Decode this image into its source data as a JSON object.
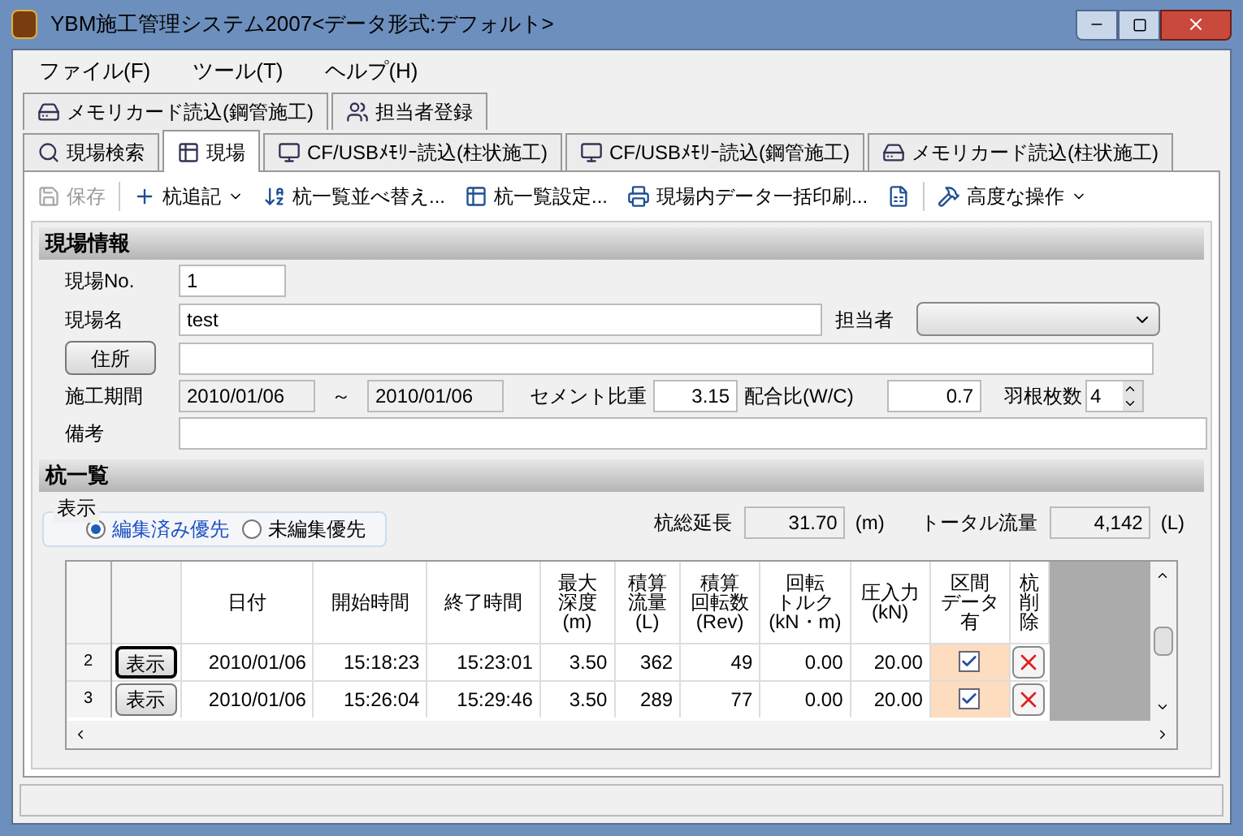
{
  "window": {
    "title": "YBM施工管理システム2007<データ形式:デフォルト>"
  },
  "menu": [
    "ファイル(F)",
    "ツール(T)",
    "ヘルプ(H)"
  ],
  "tab_rows": [
    [
      {
        "label": "メモリカード読込(鋼管施工)",
        "selected": false
      },
      {
        "label": "担当者登録",
        "selected": false
      }
    ],
    [
      {
        "label": "現場検索",
        "selected": false
      },
      {
        "label": "現場",
        "selected": true
      },
      {
        "label": "CF/USBﾒﾓﾘｰ読込(柱状施工)",
        "selected": false
      },
      {
        "label": "CF/USBﾒﾓﾘｰ読込(鋼管施工)",
        "selected": false
      },
      {
        "label": "メモリカード読込(柱状施工)",
        "selected": false
      }
    ]
  ],
  "toolbar": [
    {
      "label": "保存",
      "disabled": true,
      "dropdown": false
    },
    {
      "label": "杭追記",
      "disabled": false,
      "dropdown": true
    },
    {
      "label": "杭一覧並べ替え...",
      "disabled": false,
      "dropdown": false
    },
    {
      "label": "杭一覧設定...",
      "disabled": false,
      "dropdown": false
    },
    {
      "label": "現場内データ一括印刷...",
      "disabled": false,
      "dropdown": false
    },
    {
      "disabled": false,
      "dropdown": false
    },
    {
      "label": "高度な操作",
      "disabled": false,
      "dropdown": true
    }
  ],
  "site_info": {
    "title": "現場情報",
    "site_no_label": "現場No.",
    "site_no": "1",
    "site_name_label": "現場名",
    "site_name": "test",
    "person_label": "担当者",
    "address_button": "住所",
    "period_label": "施工期間",
    "period_start": "2010/01/06",
    "period_sep": "～",
    "period_end": "2010/01/06",
    "cement_label": "セメント比重",
    "cement": "3.15",
    "ratio_label": "配合比(W/C)",
    "ratio": "0.7",
    "blades_label": "羽根枚数",
    "blades": "4",
    "remarks_label": "備考"
  },
  "pile_list": {
    "title": "杭一覧",
    "display_label": "表示",
    "options": [
      {
        "label": "編集済み優先",
        "selected": true
      },
      {
        "label": "未編集優先",
        "selected": false
      }
    ],
    "total_length_label": "杭総延長",
    "total_length": "31.70",
    "total_length_unit": "(m)",
    "total_flow_label": "トータル流量",
    "total_flow": "4,142",
    "total_flow_unit": "(L)"
  },
  "table": {
    "columns": [
      [
        "日付"
      ],
      [
        "開始時間"
      ],
      [
        "終了時間"
      ],
      [
        "最大",
        "深度",
        "(m)"
      ],
      [
        "積算",
        "流量",
        "(L)"
      ],
      [
        "積算",
        "回転数",
        "(Rev)"
      ],
      [
        "回転",
        "トルク",
        "(kN・m)"
      ],
      [
        "圧入力",
        "(kN)"
      ],
      [
        "区間",
        "データ",
        "有"
      ],
      [
        "杭",
        "削",
        "除"
      ]
    ],
    "rows": [
      {
        "row_no": "2",
        "show": "表示",
        "date": "2010/01/06",
        "start": "15:18:23",
        "end": "15:23:01",
        "depth": "3.50",
        "flow": "362",
        "rev": "49",
        "torque": "0.00",
        "pressure": "20.00",
        "has_data": true,
        "focused": true
      },
      {
        "row_no": "3",
        "show": "表示",
        "date": "2010/01/06",
        "start": "15:26:04",
        "end": "15:29:46",
        "depth": "3.50",
        "flow": "289",
        "rev": "77",
        "torque": "0.00",
        "pressure": "20.00",
        "has_data": true,
        "focused": false
      }
    ]
  }
}
